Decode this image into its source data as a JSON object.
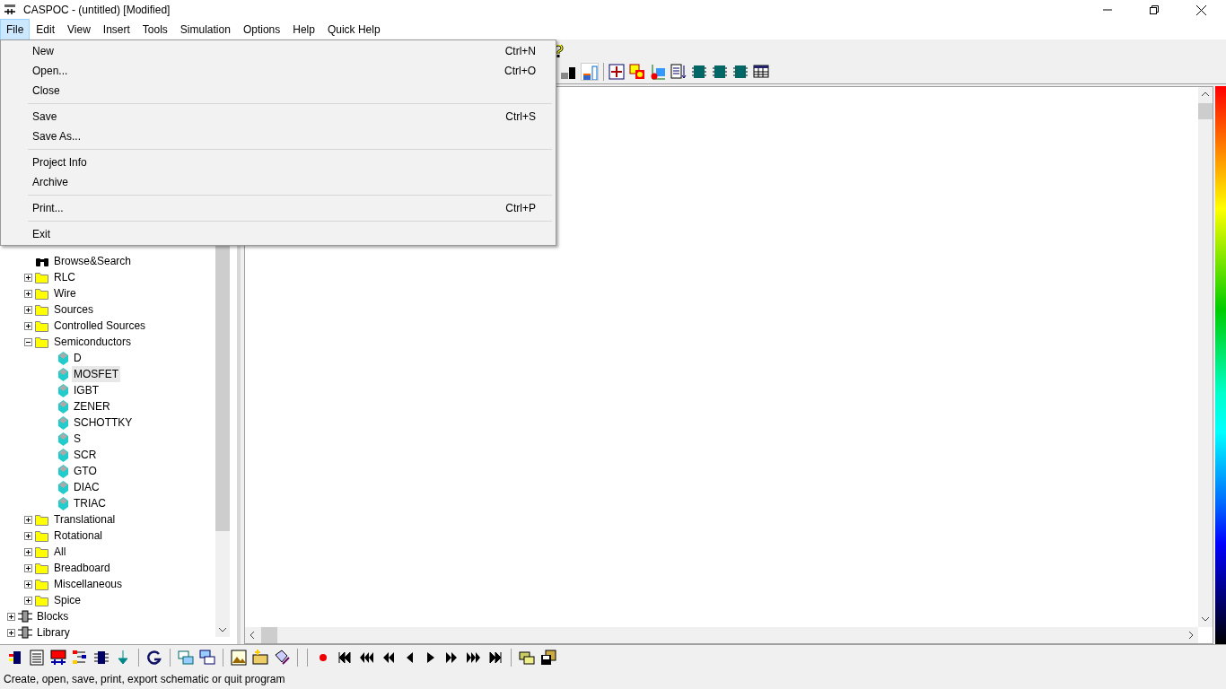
{
  "window": {
    "title": "CASPOC - (untitled) [Modified]"
  },
  "menu_bar": [
    {
      "label": "File",
      "selected": true
    },
    {
      "label": "Edit",
      "selected": false
    },
    {
      "label": "View",
      "selected": false
    },
    {
      "label": "Insert",
      "selected": false
    },
    {
      "label": "Tools",
      "selected": false
    },
    {
      "label": "Simulation",
      "selected": false
    },
    {
      "label": "Options",
      "selected": false
    },
    {
      "label": "Help",
      "selected": false
    },
    {
      "label": "Quick Help",
      "selected": false
    }
  ],
  "file_menu": [
    {
      "kind": "item",
      "label": "New",
      "shortcut": "Ctrl+N"
    },
    {
      "kind": "item",
      "label": "Open...",
      "shortcut": "Ctrl+O"
    },
    {
      "kind": "item",
      "label": "Close"
    },
    {
      "kind": "separator"
    },
    {
      "kind": "item",
      "label": "Save",
      "shortcut": "Ctrl+S"
    },
    {
      "kind": "item",
      "label": "Save As..."
    },
    {
      "kind": "separator"
    },
    {
      "kind": "item",
      "label": "Project Info"
    },
    {
      "kind": "item",
      "label": "Archive"
    },
    {
      "kind": "separator"
    },
    {
      "kind": "item",
      "label": "Print...",
      "shortcut": "Ctrl+P"
    },
    {
      "kind": "separator"
    },
    {
      "kind": "item",
      "label": "Exit"
    }
  ],
  "tree": [
    {
      "kind": "group",
      "children": [
        {
          "kind": "search",
          "label": "Browse&Search"
        },
        {
          "kind": "folder",
          "label": "RLC",
          "expanded": false
        },
        {
          "kind": "folder",
          "label": "Wire",
          "expanded": false
        },
        {
          "kind": "folder",
          "label": "Sources",
          "expanded": false
        },
        {
          "kind": "folder",
          "label": "Controlled Sources",
          "expanded": false
        },
        {
          "kind": "folder",
          "label": "Semiconductors",
          "expanded": true,
          "children": [
            {
              "kind": "component",
              "label": "D",
              "selected": false
            },
            {
              "kind": "component",
              "label": "MOSFET",
              "selected": true
            },
            {
              "kind": "component",
              "label": "IGBT",
              "selected": false
            },
            {
              "kind": "component",
              "label": "ZENER",
              "selected": false
            },
            {
              "kind": "component",
              "label": "SCHOTTKY",
              "selected": false
            },
            {
              "kind": "component",
              "label": "S",
              "selected": false
            },
            {
              "kind": "component",
              "label": "SCR",
              "selected": false
            },
            {
              "kind": "component",
              "label": "GTO",
              "selected": false
            },
            {
              "kind": "component",
              "label": "DIAC",
              "selected": false
            },
            {
              "kind": "component",
              "label": "TRIAC",
              "selected": false
            }
          ]
        },
        {
          "kind": "folder",
          "label": "Translational",
          "expanded": false
        },
        {
          "kind": "folder",
          "label": "Rotational",
          "expanded": false
        },
        {
          "kind": "folder",
          "label": "All",
          "expanded": false
        },
        {
          "kind": "folder",
          "label": "Breadboard",
          "expanded": false
        },
        {
          "kind": "folder",
          "label": "Miscellaneous",
          "expanded": false
        },
        {
          "kind": "folder",
          "label": "Spice",
          "expanded": false
        }
      ]
    },
    {
      "kind": "block",
      "label": "Blocks",
      "expanded": false
    },
    {
      "kind": "block",
      "label": "Library",
      "expanded": false
    }
  ],
  "status_bar": {
    "text": "Create, open, save, print, export schematic or quit program"
  }
}
